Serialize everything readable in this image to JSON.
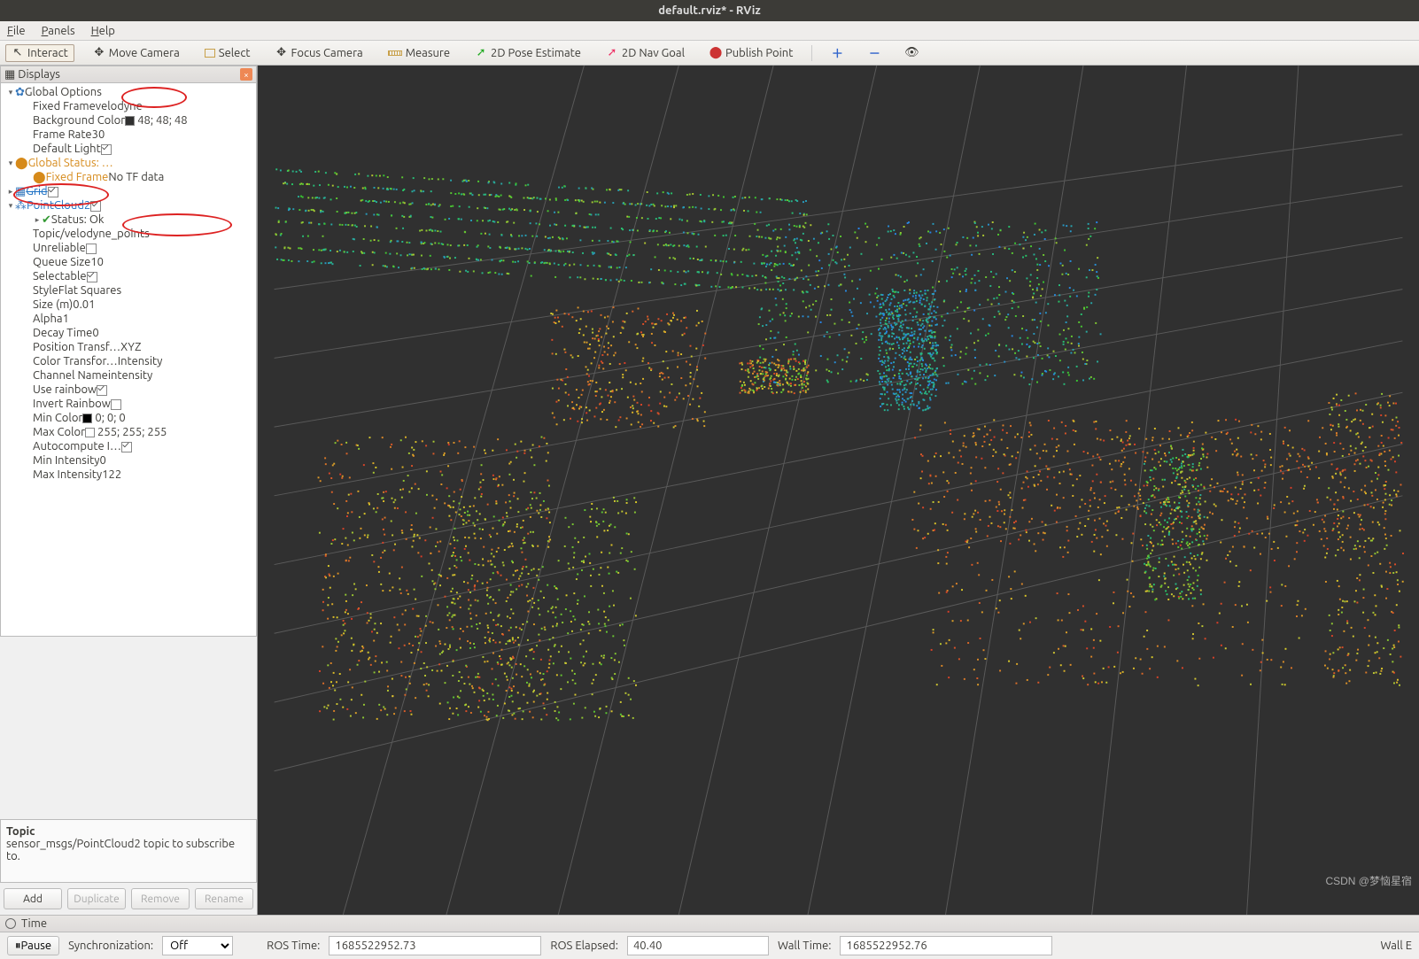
{
  "title": "default.rviz* - RViz",
  "menu": {
    "file": "File",
    "panels": "Panels",
    "help": "Help"
  },
  "toolbar": {
    "interact": "Interact",
    "move": "Move Camera",
    "select": "Select",
    "focus": "Focus Camera",
    "measure": "Measure",
    "pose": "2D Pose Estimate",
    "nav": "2D Nav Goal",
    "publish": "Publish Point"
  },
  "displays_panel": {
    "title": "Displays",
    "global_options": {
      "label": "Global Options",
      "fixed_frame": {
        "k": "Fixed Frame",
        "v": "velodyne"
      },
      "background": {
        "k": "Background Color",
        "v": "48; 48; 48"
      },
      "frame_rate": {
        "k": "Frame Rate",
        "v": "30"
      },
      "default_light": {
        "k": "Default Light",
        "checked": true
      }
    },
    "global_status": {
      "label": "Global Status: …",
      "fixed_frame": {
        "k": "Fixed Frame",
        "v": "No TF data"
      }
    },
    "grid": {
      "label": "Grid",
      "checked": true
    },
    "pointcloud2": {
      "label": "PointCloud2",
      "checked": true,
      "status": {
        "k": "Status: Ok"
      },
      "props": [
        {
          "k": "Topic",
          "v": "/velodyne_points"
        },
        {
          "k": "Unreliable",
          "chk": false
        },
        {
          "k": "Queue Size",
          "v": "10"
        },
        {
          "k": "Selectable",
          "chk": true
        },
        {
          "k": "Style",
          "v": "Flat Squares"
        },
        {
          "k": "Size (m)",
          "v": "0.01"
        },
        {
          "k": "Alpha",
          "v": "1"
        },
        {
          "k": "Decay Time",
          "v": "0"
        },
        {
          "k": "Position Transf…",
          "v": "XYZ"
        },
        {
          "k": "Color Transfor…",
          "v": "Intensity"
        },
        {
          "k": "Channel Name",
          "v": "intensity"
        },
        {
          "k": "Use rainbow",
          "chk": true
        },
        {
          "k": "Invert Rainbow",
          "chk": false
        },
        {
          "k": "Min Color",
          "v": "0; 0; 0",
          "sw": "#000"
        },
        {
          "k": "Max Color",
          "v": "255; 255; 255",
          "sw": "#fff"
        },
        {
          "k": "Autocompute I…",
          "chk": true
        },
        {
          "k": "Min Intensity",
          "v": "0"
        },
        {
          "k": "Max Intensity",
          "v": "122"
        }
      ]
    }
  },
  "desc": {
    "title": "Topic",
    "body": "sensor_msgs/PointCloud2 topic to subscribe to."
  },
  "buttons": {
    "add": "Add",
    "dup": "Duplicate",
    "rem": "Remove",
    "ren": "Rename"
  },
  "time_panel": {
    "title": "Time"
  },
  "status": {
    "pause": "Pause",
    "sync_label": "Synchronization:",
    "sync_value": "Off",
    "ros_time_label": "ROS Time:",
    "ros_time": "1685522952.73",
    "ros_elapsed_label": "ROS Elapsed:",
    "ros_elapsed": "40.40",
    "wall_time_label": "Wall Time:",
    "wall_time": "1685522952.76",
    "wall_e": "Wall E"
  },
  "watermark": "CSDN @梦恼星宿"
}
